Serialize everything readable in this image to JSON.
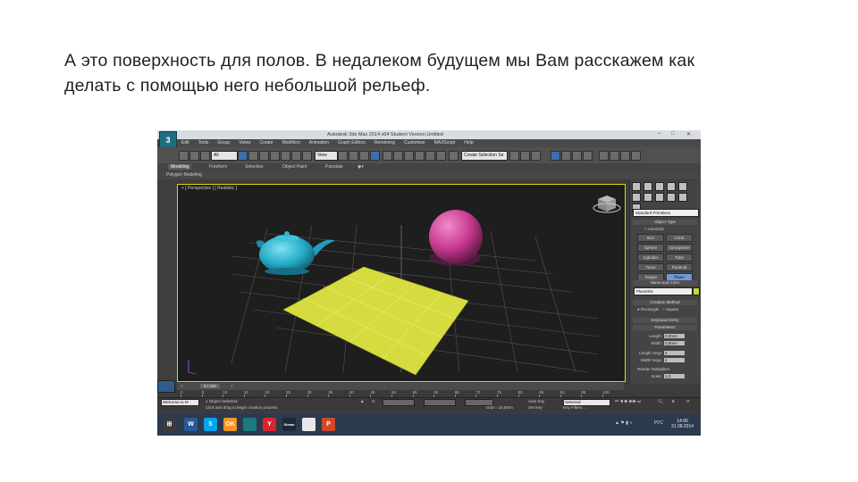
{
  "caption": {
    "line1": "А это поверхность для полов. В недалеком будущем мы Вам расскажем как",
    "line2": "делать с помощью него небольшой рельеф."
  },
  "app": {
    "title": "Autodesk 3ds Max 2014 x64    Student Version    Untitled",
    "menu": [
      "Edit",
      "Tools",
      "Group",
      "Views",
      "Create",
      "Modifiers",
      "Animation",
      "Graph Editors",
      "Rendering",
      "Customize",
      "MAXScript",
      "Help"
    ],
    "toolbar": {
      "selection_filter": "All",
      "view_dropdown": "View",
      "named_selection": "Create Selection Se"
    },
    "ribbon_tabs": [
      "Modeling",
      "Freeform",
      "Selection",
      "Object Paint",
      "Populate"
    ],
    "ribbon_active": "Modeling",
    "ribbon_sub": "Polygon Modeling",
    "viewport_label": "+ [ Perspective ] [ Realistic ]",
    "command_panel": {
      "category": "Standard Primitives",
      "object_type_header": "Object Type",
      "autogrid": "AutoGrid",
      "buttons": [
        "Box",
        "Cone",
        "Sphere",
        "GeoSphere",
        "Cylinder",
        "Tube",
        "Torus",
        "Pyramid",
        "Teapot",
        "Plane"
      ],
      "active_button": "Plane",
      "name_color_header": "Name and Color",
      "object_name": "Plane001",
      "creation_header": "Creation Method",
      "creation_options": [
        "Rectangle",
        "Square"
      ],
      "keyboard_header": "Keyboard Entry",
      "parameters_header": "Parameters",
      "params": [
        {
          "label": "Length:",
          "value": "0,0mm"
        },
        {
          "label": "Width:",
          "value": "0,0mm"
        },
        {
          "label": "Length Segs:",
          "value": "4"
        },
        {
          "label": "Width Segs:",
          "value": "4"
        },
        {
          "label": "Render Multipliers",
          "value": ""
        },
        {
          "label": "Scale:",
          "value": "1,0"
        }
      ]
    },
    "timeline": "0 / 100",
    "ruler_ticks": [
      "0",
      "5",
      "10",
      "15",
      "20",
      "25",
      "30",
      "35",
      "40",
      "45",
      "50",
      "55",
      "60",
      "65",
      "70",
      "75",
      "80",
      "85",
      "90",
      "95",
      "100"
    ],
    "status": {
      "welcome": "Welcome to M",
      "selected": "1 Object Selected",
      "prompt": "Click and drag to begin creation process",
      "x_label": "X:",
      "grid": "Grid = 10,0mm",
      "auto_key": "Auto Key",
      "set_key": "Set Key",
      "selected_mode": "Selected",
      "key_filters": "Key Filters..."
    },
    "taskbar": {
      "apps": [
        "W",
        "S",
        "OK",
        "",
        "Y",
        "Steam",
        "",
        "P"
      ],
      "clock_time": "14:00",
      "clock_date": "31.08.2014",
      "lang": "РУС"
    }
  },
  "scene": {
    "objects": [
      "teapot",
      "sphere",
      "plane"
    ],
    "colors": {
      "teapot": "#2bb5d1",
      "sphere": "#d24a9c",
      "plane": "#d6dc3f",
      "grid": "#555555",
      "viewport_border": "#e3d400",
      "background": "#1e1e1e"
    }
  }
}
